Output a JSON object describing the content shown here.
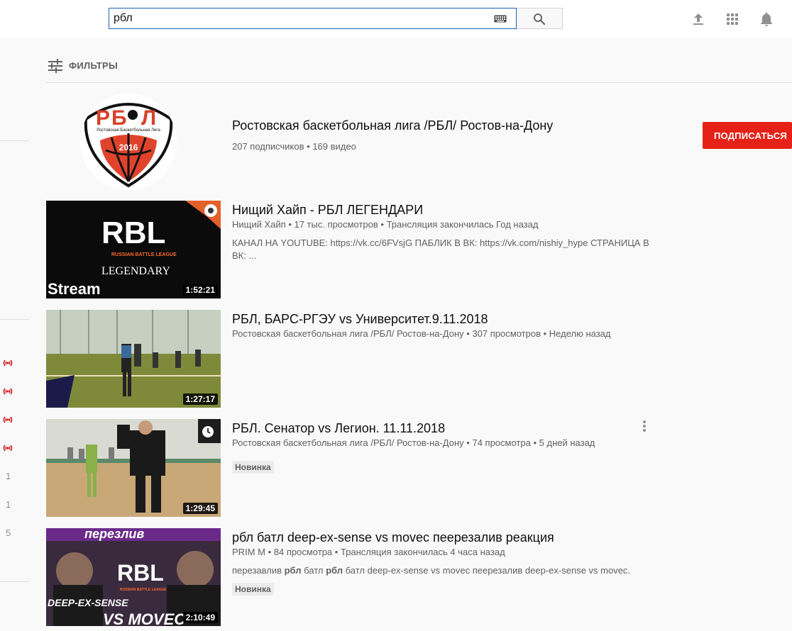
{
  "search": {
    "query": "рбл"
  },
  "left_rail": {
    "numbers": [
      "1",
      "1",
      "5"
    ]
  },
  "filters": {
    "label": "ФИЛЬТРЫ"
  },
  "channel": {
    "title": "Ростовская баскетбольная лига /РБЛ/ Ростов-на-Дону",
    "subscribers": "207 подписчиков",
    "videos": "169 видео",
    "subscribe_label": "ПОДПИСАТЬСЯ",
    "logo_text": "Ростовская Баскетбольная Лига",
    "logo_year": "2016"
  },
  "videos": [
    {
      "title": "Нищий Хайп - РБЛ ЛЕГЕНДАРИ",
      "channel": "Нищий Хайп",
      "views": "17 тыс. просмотров",
      "age": "Трансляция закончилась Год назад",
      "description": "КАНАЛ НА YOUTUBE: https://vk.cc/6FVsjG ПАБЛИК В ВК: https://vk.com/nishiy_hype СТРАНИЦА В ВК: ...",
      "duration": "1:52:21",
      "thumb_text_main": "RBL",
      "thumb_text_sub": "RUSSIAN BATTLE LEAGUE",
      "thumb_text_legend": "LEGENDARY",
      "thumb_text_stream": "Stream"
    },
    {
      "title": "РБЛ, БАРС-РГЭУ vs Университет.9.11.2018",
      "channel": "Ростовская баскетбольная лига /РБЛ/ Ростов-на-Дону",
      "views": "307 просмотров",
      "age": "Неделю назад",
      "duration": "1:27:17"
    },
    {
      "title": "РБЛ. Сенатор vs Легион. 11.11.2018",
      "channel": "Ростовская баскетбольная лига /РБЛ/ Ростов-на-Дону",
      "views": "74 просмотра",
      "age": "5 дней назад",
      "badge": "Новинка",
      "duration": "1:29:45"
    },
    {
      "title": "рбл батл deep-ex-sense vs movec пеерезалив реакция",
      "channel": "PRIM M",
      "views": "84 просмотра",
      "age": "Трансляция закончилась 4 часа назад",
      "description_parts": [
        "перезавлив ",
        "рбл",
        " батл ",
        "рбл",
        " батл deep-ex-sense vs movec пеерезалив deep-ex-sense vs movec."
      ],
      "badge": "Новинка",
      "duration": "2:10:49",
      "thumb_text_top": "перезлив",
      "thumb_text_main": "RBL",
      "thumb_text_sub": "RUSSIAN BATTLE LEAGUE",
      "thumb_text_left": "DEEP-EX-SENSE",
      "thumb_text_bottom": "VS MOVEC"
    }
  ],
  "colors": {
    "subscribe": "#e62117",
    "live": "#cc0000",
    "search_border": "#1c62b9"
  },
  "icons": [
    "keyboard-icon",
    "search-icon",
    "upload-icon",
    "apps-icon",
    "bell-icon",
    "filters-icon",
    "live-icon",
    "watch-later-icon",
    "more-vert-icon"
  ]
}
